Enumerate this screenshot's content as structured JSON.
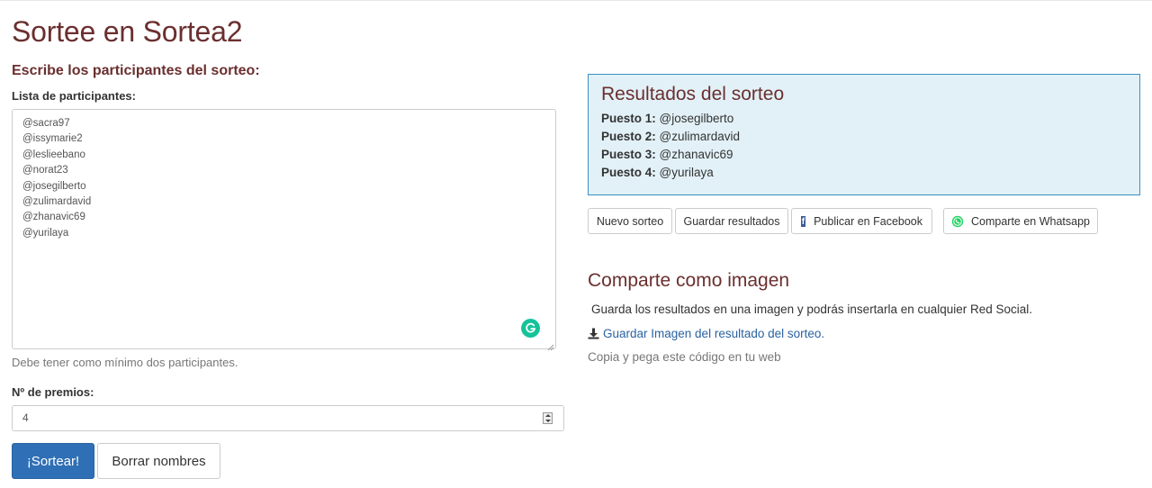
{
  "page": {
    "title": "Sortee en Sortea2",
    "participants_heading": "Escribe los participantes del sorteo:"
  },
  "form": {
    "participants_label": "Lista de participantes:",
    "participants_value": "@sacra97\n@issymarie2\n@leslieebano\n@norat23\n@josegilberto\n@zulimardavid\n@zhanavic69\n@yurilaya",
    "participants_help": "Debe tener como mínimo dos participantes.",
    "prizes_label": "Nº de premios:",
    "prizes_value": "4",
    "draw_button": "¡Sortear!",
    "clear_button": "Borrar nombres"
  },
  "results": {
    "title": "Resultados del sorteo",
    "items": [
      {
        "position": "Puesto 1:",
        "name": "@josegilberto"
      },
      {
        "position": "Puesto 2:",
        "name": "@zulimardavid"
      },
      {
        "position": "Puesto 3:",
        "name": "@zhanavic69"
      },
      {
        "position": "Puesto 4:",
        "name": "@yurilaya"
      }
    ]
  },
  "actions": {
    "new_draw": "Nuevo sorteo",
    "save_results": "Guardar resultados",
    "facebook": "Publicar en Facebook",
    "whatsapp": "Comparte en Whatsapp"
  },
  "share_image": {
    "heading": "Comparte como imagen",
    "description": "Guarda los resultados en una imagen y podrás insertarla en cualquier Red Social.",
    "download_link": "Guardar Imagen del resultado del sorteo.",
    "copy_text": "Copia y pega este código en tu web"
  },
  "icons": {
    "grammarly": "grammarly-icon",
    "facebook": "facebook-icon",
    "whatsapp": "whatsapp-icon",
    "download": "download-icon"
  },
  "colors": {
    "heading": "#6b2f2f",
    "primary": "#2f6fb5",
    "results_bg": "#e2f1f7",
    "results_border": "#3c8fc0",
    "link": "#2a62a1",
    "grammarly": "#15c39a",
    "whatsapp": "#25d366",
    "facebook": "#3b5998"
  }
}
